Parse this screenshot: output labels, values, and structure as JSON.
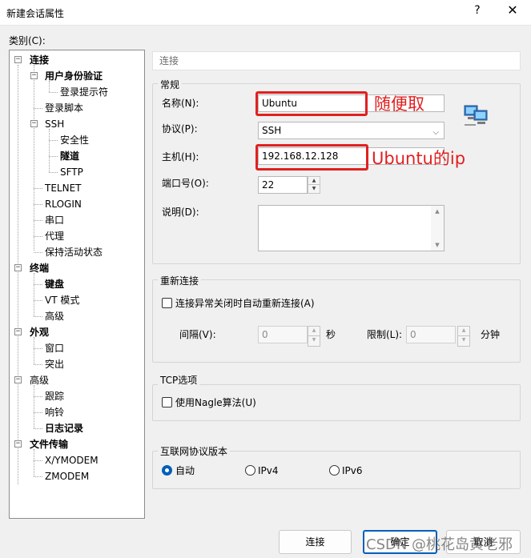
{
  "window": {
    "title": "新建会话属性",
    "help": "?",
    "close": "✕"
  },
  "category_label": "类别(C):",
  "tree": [
    {
      "label": "连接",
      "toggle": "−",
      "bold": true
    },
    {
      "label": "用户身份验证",
      "toggle": "−",
      "bold": true
    },
    {
      "label": "登录提示符",
      "toggle": "",
      "bold": false
    },
    {
      "label": "登录脚本",
      "toggle": "",
      "bold": false
    },
    {
      "label": "SSH",
      "toggle": "−",
      "bold": false
    },
    {
      "label": "安全性",
      "toggle": "",
      "bold": false
    },
    {
      "label": "隧道",
      "toggle": "",
      "bold": true
    },
    {
      "label": "SFTP",
      "toggle": "",
      "bold": false
    },
    {
      "label": "TELNET",
      "toggle": "",
      "bold": false
    },
    {
      "label": "RLOGIN",
      "toggle": "",
      "bold": false
    },
    {
      "label": "串口",
      "toggle": "",
      "bold": false
    },
    {
      "label": "代理",
      "toggle": "",
      "bold": false
    },
    {
      "label": "保持活动状态",
      "toggle": "",
      "bold": false
    },
    {
      "label": "终端",
      "toggle": "−",
      "bold": true
    },
    {
      "label": "键盘",
      "toggle": "",
      "bold": true
    },
    {
      "label": "VT 模式",
      "toggle": "",
      "bold": false
    },
    {
      "label": "高级",
      "toggle": "",
      "bold": false
    },
    {
      "label": "外观",
      "toggle": "−",
      "bold": true
    },
    {
      "label": "窗口",
      "toggle": "",
      "bold": false
    },
    {
      "label": "突出",
      "toggle": "",
      "bold": false
    },
    {
      "label": "高级",
      "toggle": "−",
      "bold": false
    },
    {
      "label": "跟踪",
      "toggle": "",
      "bold": false
    },
    {
      "label": "响铃",
      "toggle": "",
      "bold": false
    },
    {
      "label": "日志记录",
      "toggle": "",
      "bold": true
    },
    {
      "label": "文件传输",
      "toggle": "−",
      "bold": true
    },
    {
      "label": "X/YMODEM",
      "toggle": "",
      "bold": false
    },
    {
      "label": "ZMODEM",
      "toggle": "",
      "bold": false
    }
  ],
  "header": "连接",
  "general": {
    "title": "常规",
    "name_label": "名称(N):",
    "name_value": "Ubuntu",
    "name_note": "随便取",
    "protocol_label": "协议(P):",
    "protocol_value": "SSH",
    "host_label": "主机(H):",
    "host_value": "192.168.12.128",
    "host_note": "Ubuntu的ip",
    "port_label": "端口号(O):",
    "port_value": "22",
    "desc_label": "说明(D):",
    "desc_value": ""
  },
  "reconnect": {
    "title": "重新连接",
    "checkbox_label": "连接异常关闭时自动重新连接(A)",
    "interval_label": "间隔(V):",
    "interval_value": "0",
    "interval_unit": "秒",
    "limit_label": "限制(L):",
    "limit_value": "0",
    "limit_unit": "分钟"
  },
  "tcp": {
    "title": "TCP选项",
    "nagle_label": "使用Nagle算法(U)"
  },
  "ipver": {
    "title": "互联网协议版本",
    "options": [
      "自动",
      "IPv4",
      "IPv6"
    ],
    "selected": "自动"
  },
  "buttons": {
    "connect": "连接",
    "ok": "确定",
    "cancel": "取消"
  },
  "watermark": "CSDN @桃花岛黄老邪"
}
